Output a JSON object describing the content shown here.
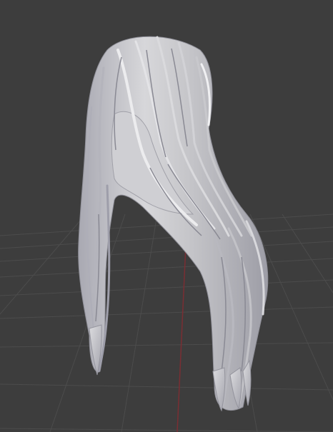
{
  "viewport": {
    "background": "#3d3d3d",
    "grid_color": "#4a4a4a",
    "x_axis_color": "#8a2f35",
    "mesh_fill": "#c9c9cc",
    "mesh_shadow": "#9a9aa3",
    "mesh_highlight": "#e6e6e8",
    "model": "long-hair-mesh",
    "shading": "solid"
  }
}
